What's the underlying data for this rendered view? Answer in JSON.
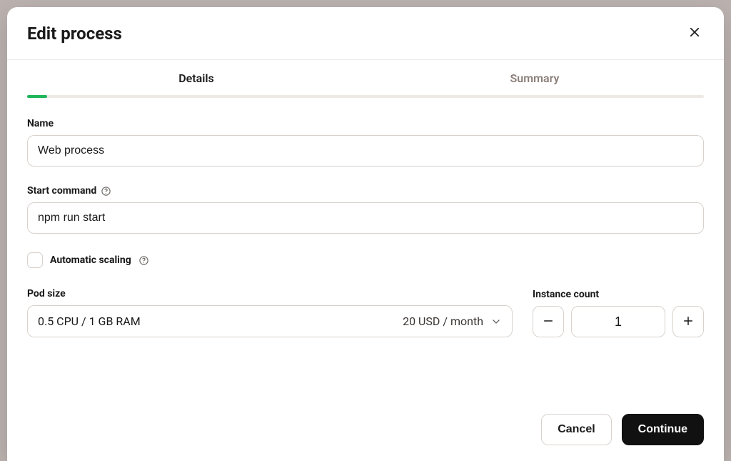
{
  "modal": {
    "title": "Edit process"
  },
  "tabs": {
    "details": "Details",
    "summary": "Summary",
    "progress_percent": 3
  },
  "fields": {
    "name": {
      "label": "Name",
      "value": "Web process"
    },
    "start_command": {
      "label": "Start command",
      "value": "npm run start"
    },
    "auto_scaling": {
      "label": "Automatic scaling",
      "checked": false
    },
    "pod_size": {
      "label": "Pod size",
      "spec": "0.5 CPU / 1 GB RAM",
      "price": "20 USD / month"
    },
    "instance_count": {
      "label": "Instance count",
      "value": "1"
    }
  },
  "footer": {
    "cancel": "Cancel",
    "continue": "Continue"
  }
}
